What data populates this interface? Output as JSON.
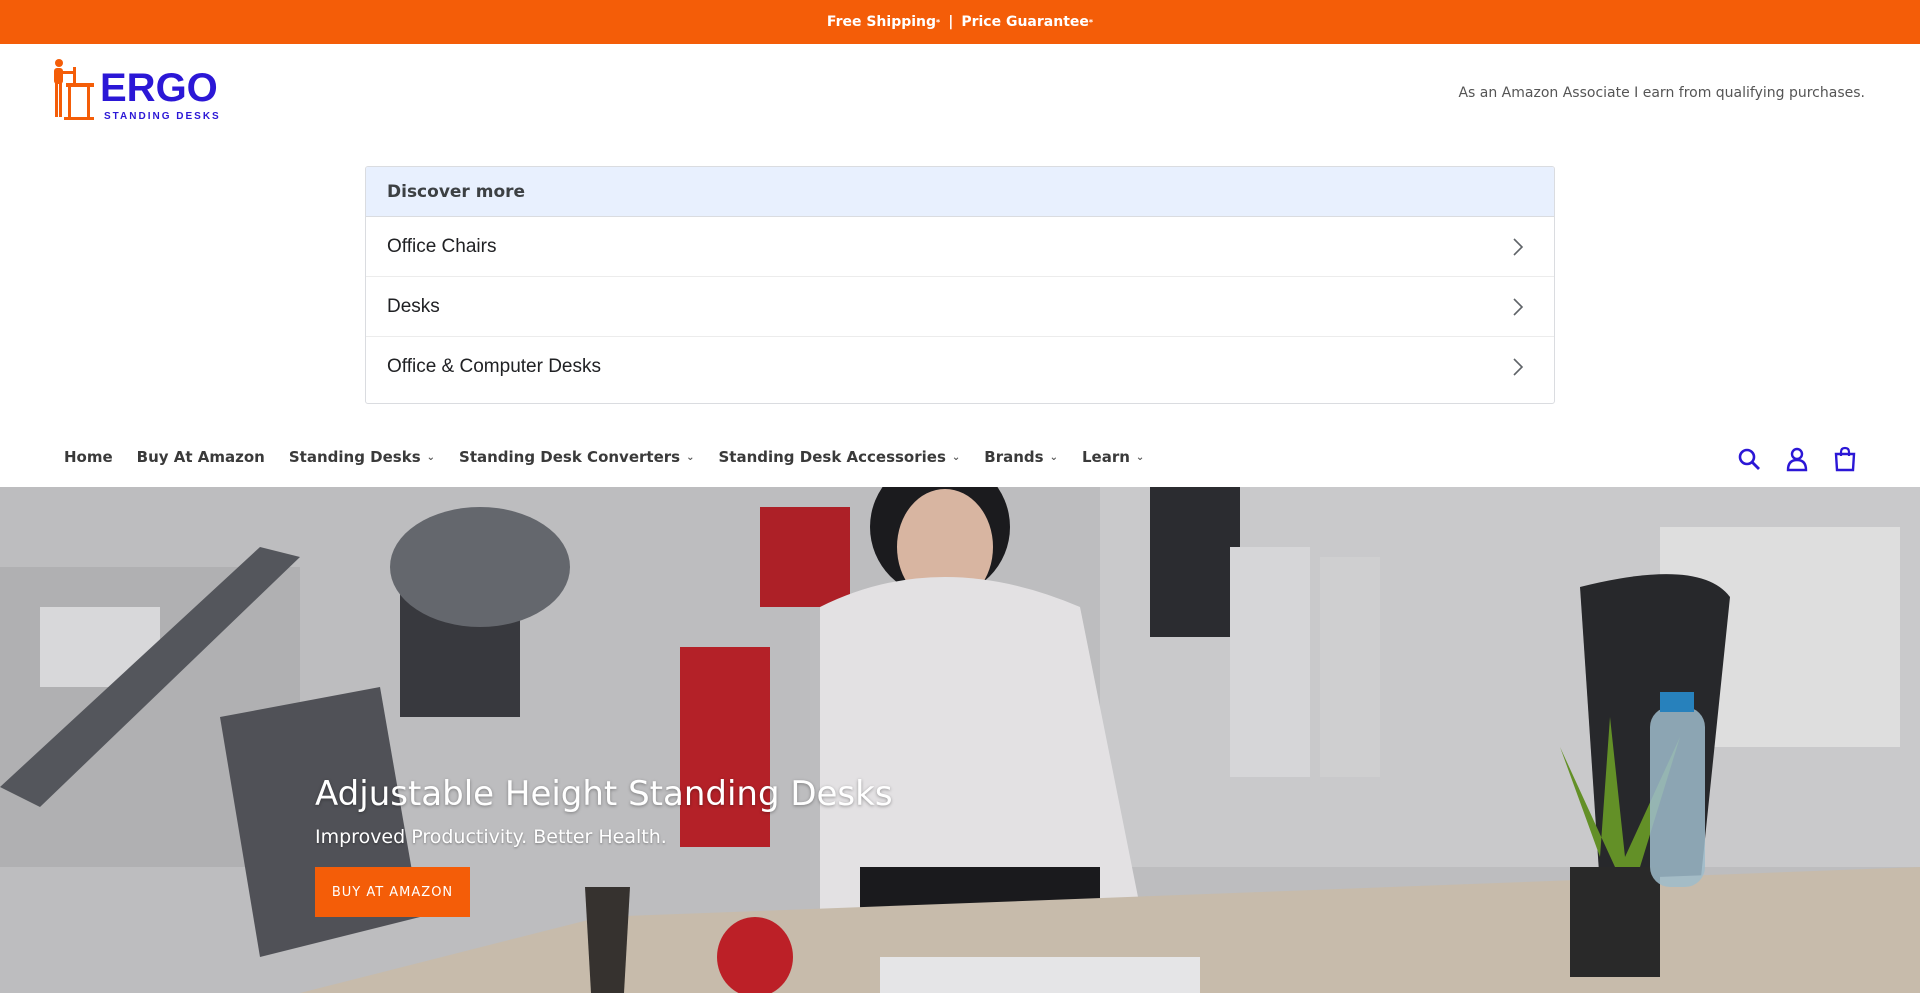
{
  "announcement": {
    "shipping": "Free Shipping",
    "separator": "|",
    "guarantee": "Price Guarantee",
    "mark": "*"
  },
  "brand": {
    "name": "ERGO",
    "tagline": "STANDING DESKS",
    "accent": "#f45d08",
    "primary": "#2b17d6"
  },
  "header": {
    "disclosure": "As an Amazon Associate I earn from qualifying purchases."
  },
  "discover": {
    "title": "Discover more",
    "items": [
      {
        "label": "Office Chairs"
      },
      {
        "label": "Desks"
      },
      {
        "label": "Office & Computer Desks"
      }
    ]
  },
  "nav": {
    "items": [
      {
        "label": "Home",
        "dropdown": false
      },
      {
        "label": "Buy At Amazon",
        "dropdown": false
      },
      {
        "label": "Standing Desks",
        "dropdown": true
      },
      {
        "label": "Standing Desk Converters",
        "dropdown": true
      },
      {
        "label": "Standing Desk Accessories",
        "dropdown": true
      },
      {
        "label": "Brands",
        "dropdown": true
      },
      {
        "label": "Learn",
        "dropdown": true
      }
    ],
    "icons": [
      "search-icon",
      "account-icon",
      "cart-icon"
    ]
  },
  "hero": {
    "title": "Adjustable Height Standing Desks",
    "subtitle": "Improved Productivity. Better Health.",
    "button": "BUY AT AMAZON"
  }
}
